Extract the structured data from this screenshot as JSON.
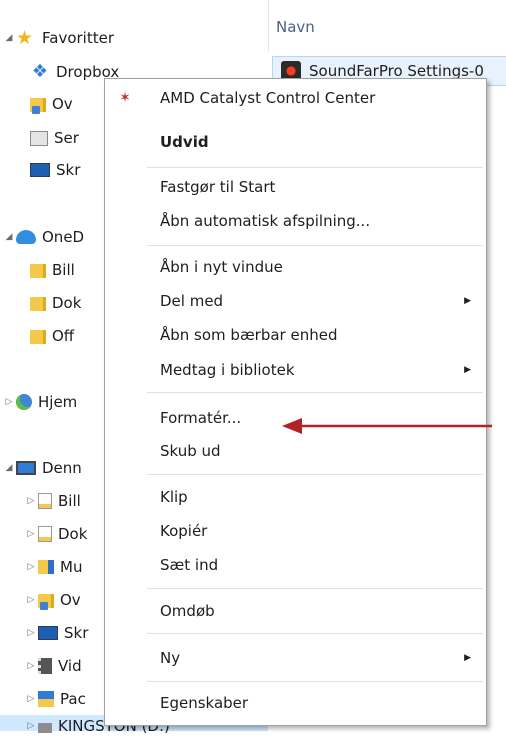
{
  "nav": {
    "favorites": "Favoritter",
    "dropbox": "Dropbox",
    "ov1": "Ov",
    "ser": "Ser",
    "skr1": "Skr",
    "onedrive": "OneD",
    "bill1": "Bill",
    "dok1": "Dok",
    "off": "Off",
    "hjem": "Hjem",
    "denne": "Denn",
    "bill2": "Bill",
    "dok2": "Dok",
    "mu": "Mu",
    "ov2": "Ov",
    "skr2": "Skr",
    "vid": "Vid",
    "pac": "Pac",
    "kingston": "KINGSTON (D:)"
  },
  "header": {
    "col_name": "Navn"
  },
  "file": {
    "name": "SoundFarPro Settings-0"
  },
  "menu": {
    "amd": "AMD Catalyst Control Center",
    "expand": "Udvid",
    "pin_start": "Fastgør til Start",
    "autoplay": "Åbn automatisk afspilning...",
    "new_window": "Åbn i nyt vindue",
    "share": "Del med",
    "portable": "Åbn som bærbar enhed",
    "library": "Medtag i bibliotek",
    "format": "Formatér...",
    "eject": "Skub ud",
    "cut": "Klip",
    "copy": "Kopiér",
    "paste": "Sæt ind",
    "rename": "Omdøb",
    "new": "Ny",
    "properties": "Egenskaber"
  },
  "colors": {
    "arrow": "#b22222",
    "selection": "#cde8ff",
    "accent": "#2e7fd6"
  }
}
